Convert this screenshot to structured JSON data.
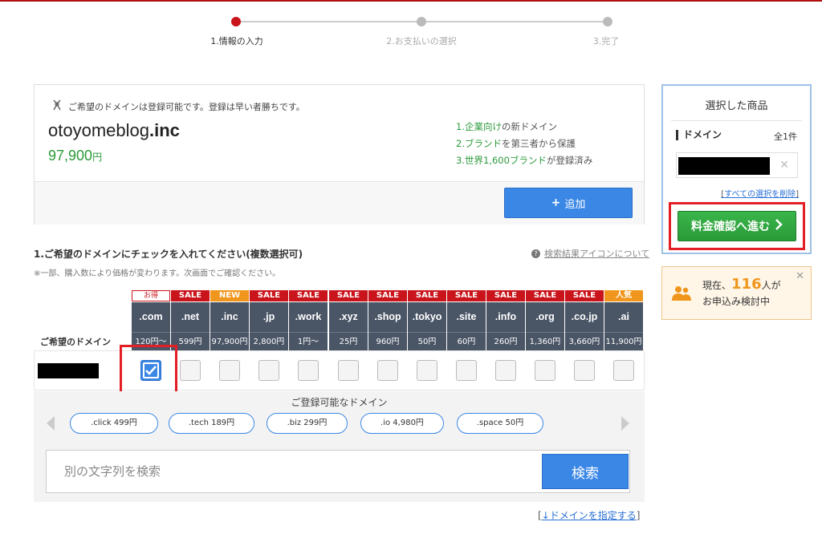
{
  "steps": [
    {
      "label": "1.情報の入力",
      "active": true
    },
    {
      "label": "2.お支払いの選択",
      "active": false
    },
    {
      "label": "3.完了",
      "active": false
    }
  ],
  "result": {
    "availability": "ご希望のドメインは登録可能です。登録は早い者勝ちです。",
    "domain_name": "otoyomeblog",
    "domain_tld": ".inc",
    "price": "97,900",
    "price_unit": "円",
    "features": [
      {
        "num": "1.",
        "green": "企業向け",
        "rest": "の新ドメイン"
      },
      {
        "num": "2.",
        "green": "ブランド",
        "rest": "を第三者から保護"
      },
      {
        "num": "3.",
        "green": "世界1,600ブランド",
        "rest": "が登録済み"
      }
    ],
    "add_button": "追加"
  },
  "cart": {
    "title": "選択した商品",
    "section": "ドメイン",
    "count": "全1件",
    "clear_link": "すべての選択を削除",
    "bracket_open": "[",
    "bracket_close": "]",
    "proceed_button": "料金確認へ進む"
  },
  "popular": {
    "prefix": "現在、",
    "number": "116",
    "suffix": "人が",
    "line2": "お申込み検討中"
  },
  "section": {
    "title": "1.ご希望のドメインにチェックを入れてください(複数選択可)",
    "note": "※一部、購入数により価格が変わります。次画面でご確認ください。",
    "icon_help": "検索結果アイコンについて",
    "row_label": "ご希望のドメイン"
  },
  "tlds": [
    {
      "badge": "お得",
      "badge_type": "otoku",
      "tld": ".com",
      "price": "120円〜",
      "checked": true
    },
    {
      "badge": "SALE",
      "badge_type": "sale",
      "tld": ".net",
      "price": "599円",
      "checked": false
    },
    {
      "badge": "NEW",
      "badge_type": "new",
      "tld": ".inc",
      "price": "97,900円",
      "checked": false
    },
    {
      "badge": "SALE",
      "badge_type": "sale",
      "tld": ".jp",
      "price": "2,800円",
      "checked": false
    },
    {
      "badge": "SALE",
      "badge_type": "sale",
      "tld": ".work",
      "price": "1円〜",
      "checked": false
    },
    {
      "badge": "SALE",
      "badge_type": "sale",
      "tld": ".xyz",
      "price": "25円",
      "checked": false
    },
    {
      "badge": "SALE",
      "badge_type": "sale",
      "tld": ".shop",
      "price": "960円",
      "checked": false
    },
    {
      "badge": "SALE",
      "badge_type": "sale",
      "tld": ".tokyo",
      "price": "50円",
      "checked": false
    },
    {
      "badge": "SALE",
      "badge_type": "sale",
      "tld": ".site",
      "price": "60円",
      "checked": false
    },
    {
      "badge": "SALE",
      "badge_type": "sale",
      "tld": ".info",
      "price": "260円",
      "checked": false
    },
    {
      "badge": "SALE",
      "badge_type": "sale",
      "tld": ".org",
      "price": "1,360円",
      "checked": false
    },
    {
      "badge": "SALE",
      "badge_type": "sale",
      "tld": ".co.jp",
      "price": "3,660円",
      "checked": false
    },
    {
      "badge": "人気",
      "badge_type": "pop",
      "tld": ".ai",
      "price": "11,900円",
      "checked": false
    }
  ],
  "suggest": {
    "title": "ご登録可能なドメイン",
    "chips": [
      ".click 499円",
      ".tech 189円",
      ".biz 299円",
      ".io 4,980円",
      ".space 50円"
    ]
  },
  "search": {
    "placeholder": "別の文字列を検索",
    "button": "検索"
  },
  "specify_link": {
    "open": "[",
    "text": "↓ドメインを指定する",
    "close": "]"
  },
  "colors": {
    "accent_blue": "#3b87e6",
    "header_dark": "#4a5566",
    "sale_red": "#c9141b",
    "green": "#2b9a3b",
    "orange": "#f0961c",
    "highlight_red": "#e31e24"
  }
}
